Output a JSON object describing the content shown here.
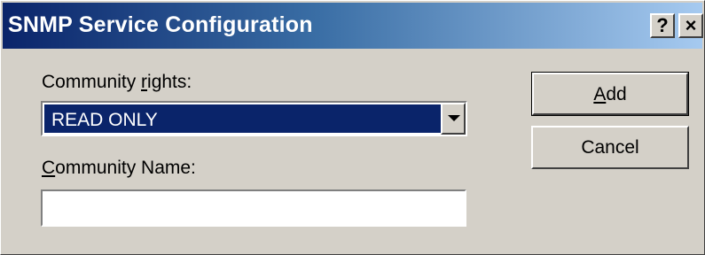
{
  "window": {
    "title": "SNMP Service Configuration",
    "help_label": "?",
    "close_label": "×"
  },
  "community_rights": {
    "label_mnemonic": "Community ",
    "label_underlined": "r",
    "label_rest": "ights:",
    "selected_value": "READ ONLY"
  },
  "community_name": {
    "label_underlined": "C",
    "label_rest": "ommunity Name:",
    "value": "",
    "placeholder": ""
  },
  "buttons": {
    "add_underlined": "A",
    "add_rest": "dd",
    "cancel_label": "Cancel"
  },
  "colors": {
    "title_bar_start": "#0a246a",
    "title_bar_end": "#a6caf0",
    "selection": "#0a246a",
    "face": "#d4d0c8"
  },
  "icons": {
    "help": "question-mark-icon",
    "close": "close-icon",
    "dropdown": "chevron-down-icon"
  }
}
